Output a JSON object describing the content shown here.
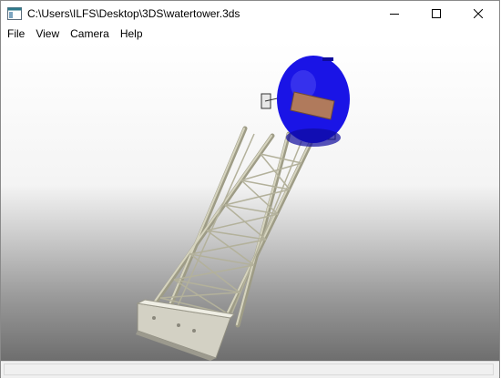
{
  "window": {
    "title": "C:\\Users\\ILFS\\Desktop\\3DS\\watertower.3ds"
  },
  "menu": [
    {
      "label": "File"
    },
    {
      "label": "View"
    },
    {
      "label": "Camera"
    },
    {
      "label": "Help"
    }
  ],
  "icons": {
    "app": "app-window-icon",
    "minimize": "minimize-icon",
    "maximize": "maximize-icon",
    "close": "close-icon"
  },
  "colors": {
    "tank": "#1a14e6",
    "tank_band": "#b07a5c",
    "tower_steel": "#b9b79f",
    "base": "#cfcdc0"
  },
  "status": {
    "text": ""
  }
}
